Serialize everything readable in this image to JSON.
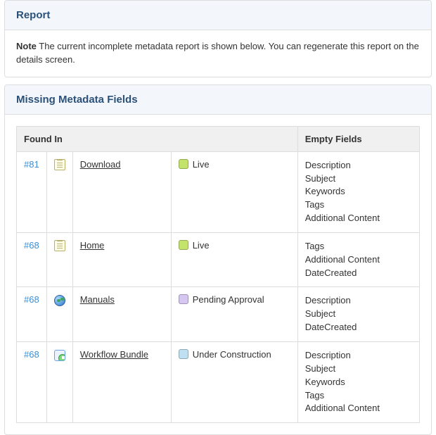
{
  "report": {
    "header": "Report",
    "note_label": "Note",
    "note_text": "The current incomplete metadata report is shown below. You can regenerate this report on the details screen."
  },
  "missing": {
    "header": "Missing Metadata Fields",
    "columns": {
      "found_in": "Found In",
      "empty_fields": "Empty Fields"
    },
    "status_colors": {
      "Live": "#c3e36a",
      "Pending Approval": "#d6c6f2",
      "Under Construction": "#bfe0f2"
    },
    "rows": [
      {
        "id_label": "#81",
        "icon": "page",
        "name": "Download",
        "status": "Live",
        "fields": [
          "Description",
          "Subject",
          "Keywords",
          "Tags",
          "Additional Content"
        ]
      },
      {
        "id_label": "#68",
        "icon": "page",
        "name": "Home",
        "status": "Live",
        "fields": [
          "Tags",
          "Additional Content",
          "DateCreated"
        ]
      },
      {
        "id_label": "#68",
        "icon": "globe",
        "name": "Manuals",
        "status": "Pending Approval",
        "fields": [
          "Description",
          "Subject",
          "DateCreated"
        ]
      },
      {
        "id_label": "#68",
        "icon": "bundle",
        "name": "Workflow Bundle",
        "status": "Under Construction",
        "fields": [
          "Description",
          "Subject",
          "Keywords",
          "Tags",
          "Additional Content"
        ]
      }
    ]
  }
}
